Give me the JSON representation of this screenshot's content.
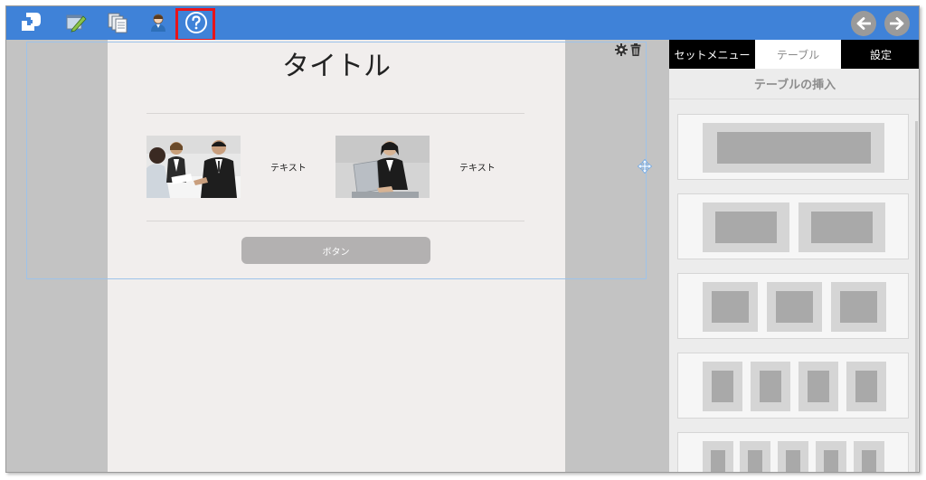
{
  "toolbar": {
    "icons": [
      "logo-icon",
      "edit-page-icon",
      "pages-icon",
      "user-icon",
      "help-icon"
    ],
    "nav": [
      "back-arrow-icon",
      "forward-arrow-icon"
    ],
    "accent_color": "#3f82d8",
    "highlight_color": "#e8141b"
  },
  "page": {
    "title": "タイトル",
    "items": [
      {
        "image": "business-meeting-photo",
        "text": "テキスト"
      },
      {
        "image": "businesswoman-laptop-photo",
        "text": "テキスト"
      }
    ],
    "button_label": "ボタン"
  },
  "panel": {
    "tabs": [
      "セットメニュー",
      "テーブル",
      "設定"
    ],
    "active_tab": "テーブル",
    "heading": "テーブルの挿入",
    "templates": [
      "1-column",
      "2-columns",
      "3-columns",
      "4-columns",
      "5-columns"
    ]
  }
}
